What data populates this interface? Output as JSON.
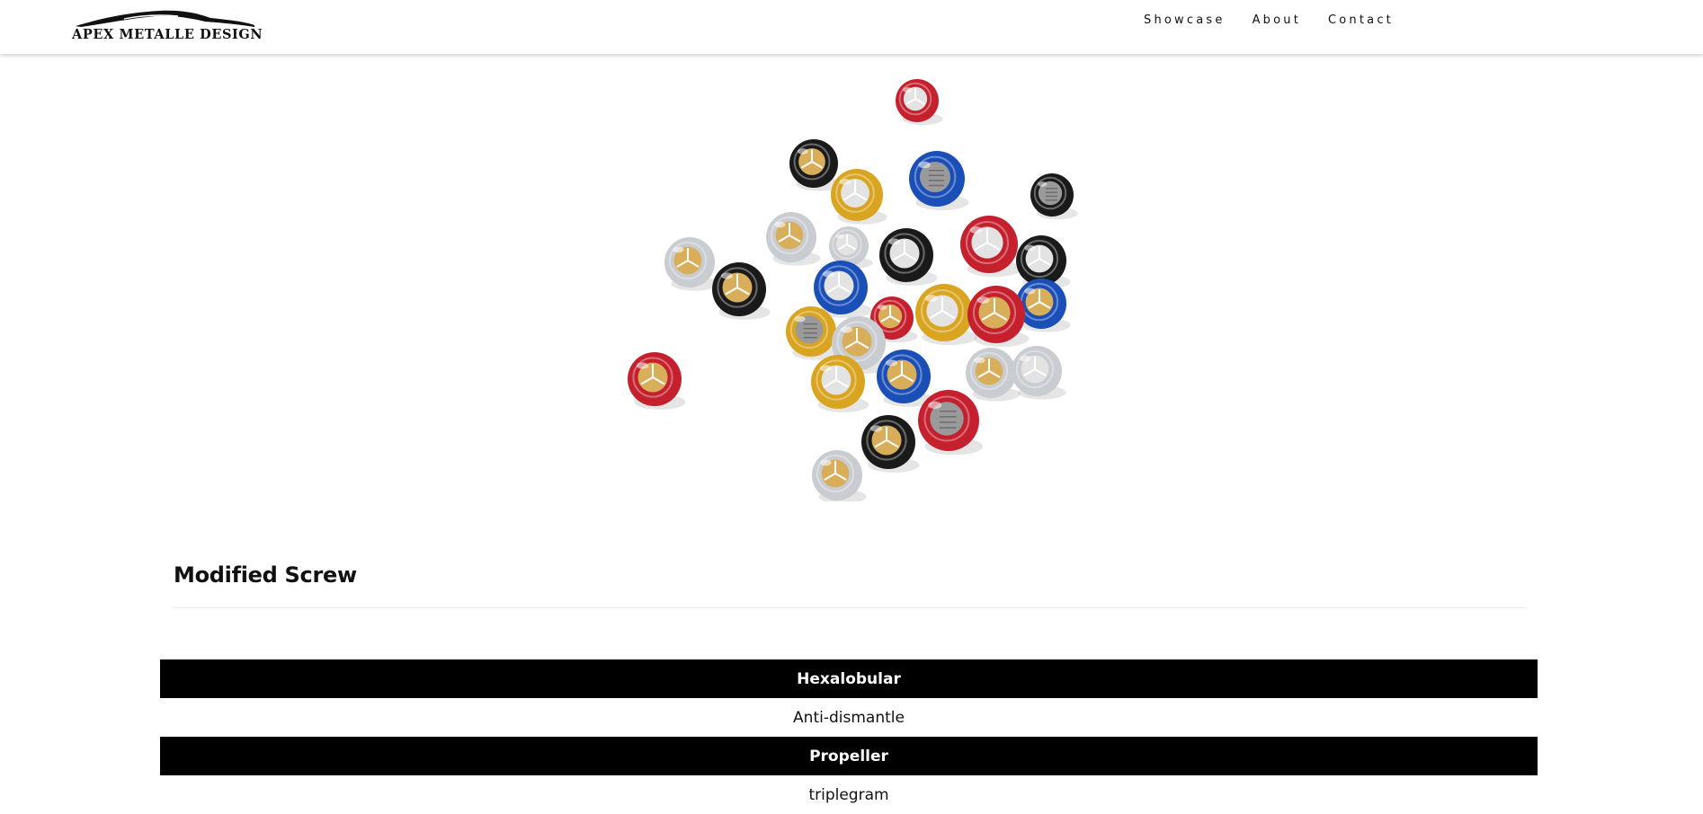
{
  "header": {
    "brand": "APEX METALLE DESIGN",
    "nav": [
      "Showcase",
      "About",
      "Contact"
    ]
  },
  "hero": {
    "image_alt": "colorful modified screws"
  },
  "product": {
    "title": "Modified Screw"
  },
  "table": {
    "rows": [
      {
        "text": "Hexalobular",
        "style": "dark"
      },
      {
        "text": "Anti-dismantle",
        "style": "light"
      },
      {
        "text": "Propeller",
        "style": "dark"
      },
      {
        "text": "triplegram",
        "style": "light"
      }
    ]
  },
  "colors": {
    "header_bg": "#ffffff",
    "row_dark": "#000000",
    "row_light": "#ffffff",
    "screw_red": "#c4202e",
    "screw_blue": "#1b4fb8",
    "screw_gold": "#d9a520",
    "screw_black": "#1a1a1a",
    "screw_silver": "#c9ccd0"
  }
}
